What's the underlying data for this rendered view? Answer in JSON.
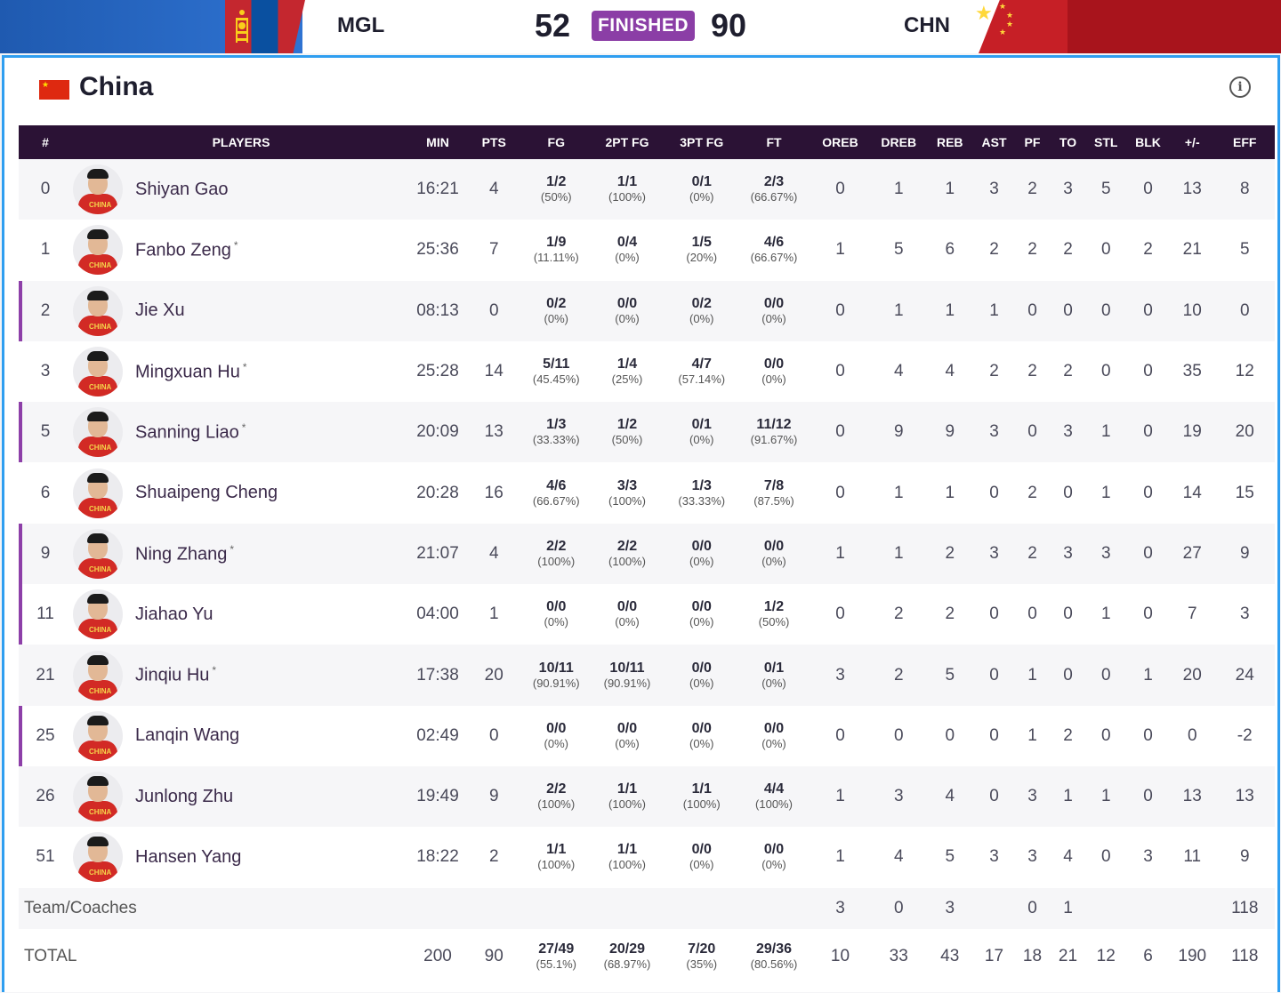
{
  "scoreboard": {
    "home_code": "MGL",
    "home_score": "52",
    "status": "FINISHED",
    "away_score": "90",
    "away_code": "CHN"
  },
  "team": {
    "name": "China"
  },
  "columns": [
    "#",
    "PLAYERS",
    "MIN",
    "PTS",
    "FG",
    "2PT FG",
    "3PT FG",
    "FT",
    "OREB",
    "DREB",
    "REB",
    "AST",
    "PF",
    "TO",
    "STL",
    "BLK",
    "+/-",
    "EFF"
  ],
  "avatar_jersey_text": "CHINA",
  "players": [
    {
      "num": "0",
      "name": "Shiyan Gao",
      "star": "",
      "starter": false,
      "min": "16:21",
      "pts": "4",
      "fg": "1/2",
      "fg_pct": "(50%)",
      "fg2": "1/1",
      "fg2_pct": "(100%)",
      "fg3": "0/1",
      "fg3_pct": "(0%)",
      "ft": "2/3",
      "ft_pct": "(66.67%)",
      "oreb": "0",
      "dreb": "1",
      "reb": "1",
      "ast": "3",
      "pf": "2",
      "to": "3",
      "stl": "5",
      "blk": "0",
      "pm": "13",
      "eff": "8"
    },
    {
      "num": "1",
      "name": "Fanbo Zeng",
      "star": "*",
      "starter": false,
      "min": "25:36",
      "pts": "7",
      "fg": "1/9",
      "fg_pct": "(11.11%)",
      "fg2": "0/4",
      "fg2_pct": "(0%)",
      "fg3": "1/5",
      "fg3_pct": "(20%)",
      "ft": "4/6",
      "ft_pct": "(66.67%)",
      "oreb": "1",
      "dreb": "5",
      "reb": "6",
      "ast": "2",
      "pf": "2",
      "to": "2",
      "stl": "0",
      "blk": "2",
      "pm": "21",
      "eff": "5"
    },
    {
      "num": "2",
      "name": "Jie Xu",
      "star": "",
      "starter": true,
      "min": "08:13",
      "pts": "0",
      "fg": "0/2",
      "fg_pct": "(0%)",
      "fg2": "0/0",
      "fg2_pct": "(0%)",
      "fg3": "0/2",
      "fg3_pct": "(0%)",
      "ft": "0/0",
      "ft_pct": "(0%)",
      "oreb": "0",
      "dreb": "1",
      "reb": "1",
      "ast": "1",
      "pf": "0",
      "to": "0",
      "stl": "0",
      "blk": "0",
      "pm": "10",
      "eff": "0"
    },
    {
      "num": "3",
      "name": "Mingxuan Hu",
      "star": "*",
      "starter": false,
      "min": "25:28",
      "pts": "14",
      "fg": "5/11",
      "fg_pct": "(45.45%)",
      "fg2": "1/4",
      "fg2_pct": "(25%)",
      "fg3": "4/7",
      "fg3_pct": "(57.14%)",
      "ft": "0/0",
      "ft_pct": "(0%)",
      "oreb": "0",
      "dreb": "4",
      "reb": "4",
      "ast": "2",
      "pf": "2",
      "to": "2",
      "stl": "0",
      "blk": "0",
      "pm": "35",
      "eff": "12"
    },
    {
      "num": "5",
      "name": "Sanning Liao",
      "star": "*",
      "starter": true,
      "min": "20:09",
      "pts": "13",
      "fg": "1/3",
      "fg_pct": "(33.33%)",
      "fg2": "1/2",
      "fg2_pct": "(50%)",
      "fg3": "0/1",
      "fg3_pct": "(0%)",
      "ft": "11/12",
      "ft_pct": "(91.67%)",
      "oreb": "0",
      "dreb": "9",
      "reb": "9",
      "ast": "3",
      "pf": "0",
      "to": "3",
      "stl": "1",
      "blk": "0",
      "pm": "19",
      "eff": "20"
    },
    {
      "num": "6",
      "name": "Shuaipeng Cheng",
      "star": "",
      "starter": false,
      "min": "20:28",
      "pts": "16",
      "fg": "4/6",
      "fg_pct": "(66.67%)",
      "fg2": "3/3",
      "fg2_pct": "(100%)",
      "fg3": "1/3",
      "fg3_pct": "(33.33%)",
      "ft": "7/8",
      "ft_pct": "(87.5%)",
      "oreb": "0",
      "dreb": "1",
      "reb": "1",
      "ast": "0",
      "pf": "2",
      "to": "0",
      "stl": "1",
      "blk": "0",
      "pm": "14",
      "eff": "15"
    },
    {
      "num": "9",
      "name": "Ning Zhang",
      "star": "*",
      "starter": true,
      "min": "21:07",
      "pts": "4",
      "fg": "2/2",
      "fg_pct": "(100%)",
      "fg2": "2/2",
      "fg2_pct": "(100%)",
      "fg3": "0/0",
      "fg3_pct": "(0%)",
      "ft": "0/0",
      "ft_pct": "(0%)",
      "oreb": "1",
      "dreb": "1",
      "reb": "2",
      "ast": "3",
      "pf": "2",
      "to": "3",
      "stl": "3",
      "blk": "0",
      "pm": "27",
      "eff": "9"
    },
    {
      "num": "11",
      "name": "Jiahao Yu",
      "star": "",
      "starter": true,
      "min": "04:00",
      "pts": "1",
      "fg": "0/0",
      "fg_pct": "(0%)",
      "fg2": "0/0",
      "fg2_pct": "(0%)",
      "fg3": "0/0",
      "fg3_pct": "(0%)",
      "ft": "1/2",
      "ft_pct": "(50%)",
      "oreb": "0",
      "dreb": "2",
      "reb": "2",
      "ast": "0",
      "pf": "0",
      "to": "0",
      "stl": "1",
      "blk": "0",
      "pm": "7",
      "eff": "3"
    },
    {
      "num": "21",
      "name": "Jinqiu Hu",
      "star": "*",
      "starter": false,
      "min": "17:38",
      "pts": "20",
      "fg": "10/11",
      "fg_pct": "(90.91%)",
      "fg2": "10/11",
      "fg2_pct": "(90.91%)",
      "fg3": "0/0",
      "fg3_pct": "(0%)",
      "ft": "0/1",
      "ft_pct": "(0%)",
      "oreb": "3",
      "dreb": "2",
      "reb": "5",
      "ast": "0",
      "pf": "1",
      "to": "0",
      "stl": "0",
      "blk": "1",
      "pm": "20",
      "eff": "24"
    },
    {
      "num": "25",
      "name": "Lanqin Wang",
      "star": "",
      "starter": true,
      "min": "02:49",
      "pts": "0",
      "fg": "0/0",
      "fg_pct": "(0%)",
      "fg2": "0/0",
      "fg2_pct": "(0%)",
      "fg3": "0/0",
      "fg3_pct": "(0%)",
      "ft": "0/0",
      "ft_pct": "(0%)",
      "oreb": "0",
      "dreb": "0",
      "reb": "0",
      "ast": "0",
      "pf": "1",
      "to": "2",
      "stl": "0",
      "blk": "0",
      "pm": "0",
      "eff": "-2"
    },
    {
      "num": "26",
      "name": "Junlong Zhu",
      "star": "",
      "starter": false,
      "min": "19:49",
      "pts": "9",
      "fg": "2/2",
      "fg_pct": "(100%)",
      "fg2": "1/1",
      "fg2_pct": "(100%)",
      "fg3": "1/1",
      "fg3_pct": "(100%)",
      "ft": "4/4",
      "ft_pct": "(100%)",
      "oreb": "1",
      "dreb": "3",
      "reb": "4",
      "ast": "0",
      "pf": "3",
      "to": "1",
      "stl": "1",
      "blk": "0",
      "pm": "13",
      "eff": "13"
    },
    {
      "num": "51",
      "name": "Hansen Yang",
      "star": "",
      "starter": false,
      "min": "18:22",
      "pts": "2",
      "fg": "1/1",
      "fg_pct": "(100%)",
      "fg2": "1/1",
      "fg2_pct": "(100%)",
      "fg3": "0/0",
      "fg3_pct": "(0%)",
      "ft": "0/0",
      "ft_pct": "(0%)",
      "oreb": "1",
      "dreb": "4",
      "reb": "5",
      "ast": "3",
      "pf": "3",
      "to": "4",
      "stl": "0",
      "blk": "3",
      "pm": "11",
      "eff": "9"
    }
  ],
  "team_row": {
    "label": "Team/Coaches",
    "oreb": "3",
    "dreb": "0",
    "reb": "3",
    "ast": "",
    "pf": "0",
    "to": "1",
    "stl": "",
    "blk": "",
    "pm": "",
    "eff": "118"
  },
  "total_row": {
    "label": "TOTAL",
    "min": "200",
    "pts": "90",
    "fg": "27/49",
    "fg_pct": "(55.1%)",
    "fg2": "20/29",
    "fg2_pct": "(68.97%)",
    "fg3": "7/20",
    "fg3_pct": "(35%)",
    "ft": "29/36",
    "ft_pct": "(80.56%)",
    "oreb": "10",
    "dreb": "33",
    "reb": "43",
    "ast": "17",
    "pf": "18",
    "to": "21",
    "stl": "12",
    "blk": "6",
    "pm": "190",
    "eff": "118"
  },
  "colors": {
    "header_bg": "#2b1235",
    "status_badge": "#8b3ea6",
    "panel_border": "#2f9ef0",
    "starter_bar": "#8d3fa8"
  }
}
